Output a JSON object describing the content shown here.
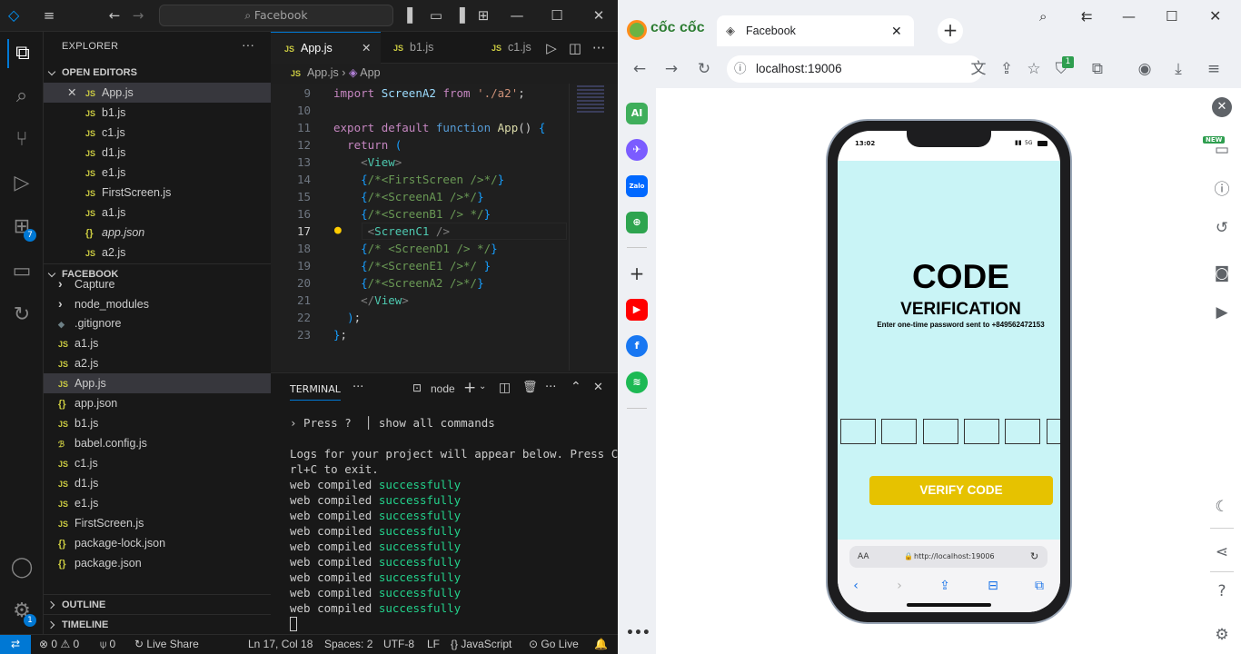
{
  "vscode": {
    "search_text": "Facebook",
    "explorer_title": "EXPLORER",
    "open_editors_label": "OPEN EDITORS",
    "open_editors": [
      {
        "icon": "JS",
        "name": "App.js"
      },
      {
        "icon": "JS",
        "name": "b1.js"
      },
      {
        "icon": "JS",
        "name": "c1.js"
      },
      {
        "icon": "JS",
        "name": "d1.js"
      },
      {
        "icon": "JS",
        "name": "e1.js"
      },
      {
        "icon": "JS",
        "name": "FirstScreen.js"
      },
      {
        "icon": "JS",
        "name": "a1.js"
      },
      {
        "icon": "{}",
        "name": "app.json"
      },
      {
        "icon": "JS",
        "name": "a2.js"
      }
    ],
    "project_label": "FACEBOOK",
    "files": [
      {
        "icon": "",
        "name": "Capture"
      },
      {
        "icon": "",
        "name": "node_modules"
      },
      {
        "icon": "",
        "name": ".gitignore"
      },
      {
        "icon": "JS",
        "name": "a1.js"
      },
      {
        "icon": "JS",
        "name": "a2.js"
      },
      {
        "icon": "JS",
        "name": "App.js"
      },
      {
        "icon": "{}",
        "name": "app.json"
      },
      {
        "icon": "JS",
        "name": "b1.js"
      },
      {
        "icon": "",
        "name": "babel.config.js"
      },
      {
        "icon": "JS",
        "name": "c1.js"
      },
      {
        "icon": "JS",
        "name": "d1.js"
      },
      {
        "icon": "JS",
        "name": "e1.js"
      },
      {
        "icon": "JS",
        "name": "FirstScreen.js"
      },
      {
        "icon": "{}",
        "name": "package-lock.json"
      },
      {
        "icon": "{}",
        "name": "package.json"
      }
    ],
    "outline_label": "OUTLINE",
    "timeline_label": "TIMELINE",
    "tabs": [
      {
        "icon": "JS",
        "label": "App.js"
      },
      {
        "icon": "JS",
        "label": "b1.js"
      },
      {
        "icon": "JS",
        "label": "c1.js"
      }
    ],
    "breadcrumb_file": "App.js",
    "breadcrumb_symbol": "App",
    "line_numbers": [
      "9",
      "10",
      "11",
      "12",
      "13",
      "14",
      "15",
      "16",
      "17",
      "18",
      "19",
      "20",
      "21",
      "22",
      "23"
    ],
    "current_line": "17",
    "terminal_tab": "TERMINAL",
    "terminal_shell": "node",
    "terminal_lines": [
      "› Press ?  │ show all commands",
      "",
      "Logs for your project will appear below. Press Ct",
      "rl+C to exit."
    ],
    "compiled_prefix": "web compiled",
    "compiled_word": "successfully",
    "status": {
      "errors": "0",
      "warnings": "0",
      "ports": "0",
      "live_share": "Live Share",
      "position": "Ln 17, Col 18",
      "spaces": "Spaces: 2",
      "encoding": "UTF-8",
      "eol": "LF",
      "language": "JavaScript",
      "go_live": "Go Live"
    },
    "extensions_badge": "7",
    "settings_badge": "1"
  },
  "browser": {
    "brand": "cốc cốc",
    "tab_title": "Facebook",
    "url": "localhost:19006",
    "extension_badge": "1",
    "new_badge": "NEW",
    "sidebar_ai": "AI",
    "sidebar_zalo": "Zalo"
  },
  "phone": {
    "time": "13:02",
    "network": "5G",
    "heading": "CODE",
    "subheading": "VERIFICATION",
    "instruction": "Enter one-time password sent to +849562472153",
    "verify_label": "VERIFY CODE",
    "safari_aa": "AA",
    "safari_url": "http://localhost:19006"
  },
  "colors": {
    "accent": "#0078d4",
    "verify": "#e6c200",
    "app_bg": "#c9f4f6",
    "ok": "#23d18b"
  }
}
